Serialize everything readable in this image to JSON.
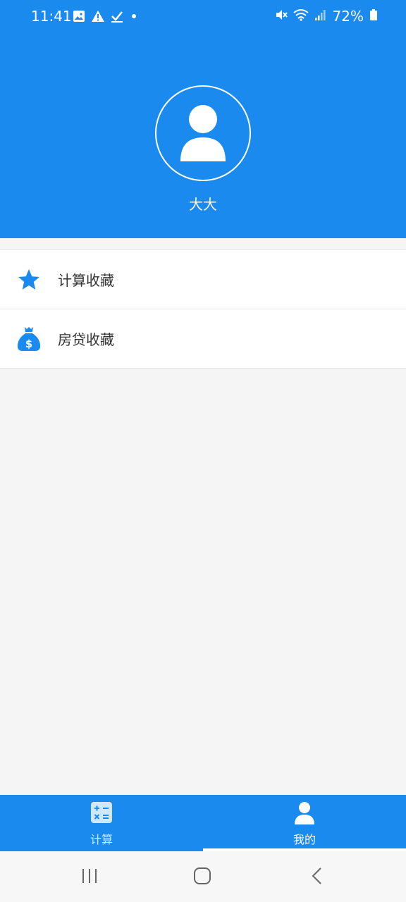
{
  "status_bar": {
    "time": "11:41",
    "battery": "72%",
    "icons_left": [
      "image-icon",
      "warning-icon",
      "check-icon",
      "dot-icon"
    ],
    "icons_right": [
      "mute-icon",
      "wifi-icon",
      "signal-icon",
      "battery-icon"
    ]
  },
  "profile": {
    "username": "大大",
    "avatar_icon": "user-icon"
  },
  "menu": {
    "items": [
      {
        "label": "计算收藏",
        "icon": "star-icon"
      },
      {
        "label": "房贷收藏",
        "icon": "money-bag-icon"
      }
    ]
  },
  "tabbar": {
    "tabs": [
      {
        "label": "计算",
        "icon": "calculator-icon",
        "active": false
      },
      {
        "label": "我的",
        "icon": "user-icon",
        "active": true
      }
    ]
  },
  "navigation": {
    "buttons": [
      "recent-apps-icon",
      "home-icon",
      "back-icon"
    ]
  },
  "colors": {
    "primary": "#1a8aef",
    "background": "#f5f5f5"
  }
}
